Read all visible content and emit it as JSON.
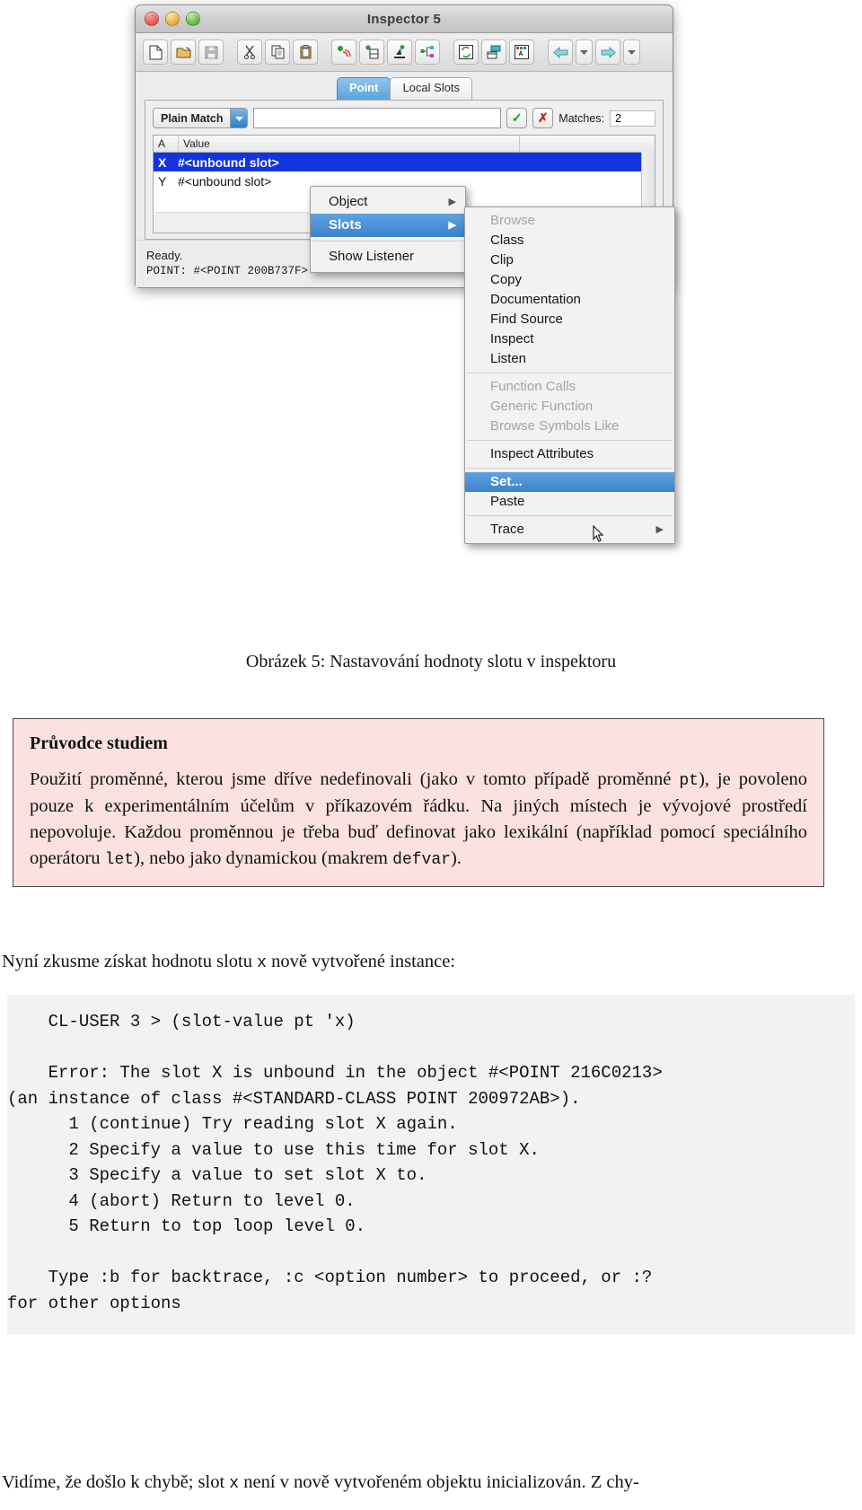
{
  "window": {
    "title": "Inspector 5",
    "traffic_lights": [
      "close",
      "minimize",
      "zoom"
    ],
    "toolbar_icons": [
      "new-document-icon",
      "open-folder-icon",
      "save-disk-icon",
      "cut-scissors-icon",
      "copy-icon",
      "paste-clipboard-icon",
      "listener-icon",
      "clip-icon",
      "inspect-microscope-icon",
      "class-tree-icon",
      "refresh-icon",
      "browse-icon",
      "attributes-icon",
      "back-arrow-icon",
      "back-dropdown-icon",
      "forward-arrow-icon",
      "forward-dropdown-icon"
    ],
    "tabs": [
      {
        "label": "Point",
        "active": true
      },
      {
        "label": "Local Slots",
        "active": false
      }
    ],
    "filter": {
      "match_mode": "Plain Match",
      "match_mode_options": [
        "Plain Match"
      ],
      "query_value": "",
      "query_placeholder": "",
      "accept_icon": "check-icon",
      "reject_icon": "cross-icon",
      "matches_label": "Matches:",
      "matches_count": "2"
    },
    "slot_table": {
      "columns": [
        "A",
        "Value"
      ],
      "rows": [
        {
          "name": "X",
          "value": "#<unbound slot>",
          "selected": true
        },
        {
          "name": "Y",
          "value": "#<unbound slot>",
          "selected": false
        }
      ]
    },
    "status": {
      "line1": "Ready.",
      "line2": "POINT: #<POINT 200B737F>"
    }
  },
  "context_menu": {
    "items": [
      {
        "label": "Object",
        "submenu": true,
        "highlighted": false,
        "disabled": false
      },
      {
        "label": "Slots",
        "submenu": true,
        "highlighted": true,
        "disabled": false
      },
      {
        "separator": true
      },
      {
        "label": "Show Listener",
        "submenu": false,
        "highlighted": false,
        "disabled": false
      }
    ]
  },
  "submenu": {
    "items": [
      {
        "label": "Browse",
        "disabled": true,
        "highlighted": false,
        "submenu": false
      },
      {
        "label": "Class",
        "disabled": false,
        "highlighted": false,
        "submenu": false
      },
      {
        "label": "Clip",
        "disabled": false,
        "highlighted": false,
        "submenu": false
      },
      {
        "label": "Copy",
        "disabled": false,
        "highlighted": false,
        "submenu": false
      },
      {
        "label": "Documentation",
        "disabled": false,
        "highlighted": false,
        "submenu": false
      },
      {
        "label": "Find Source",
        "disabled": false,
        "highlighted": false,
        "submenu": false
      },
      {
        "label": "Inspect",
        "disabled": false,
        "highlighted": false,
        "submenu": false
      },
      {
        "label": "Listen",
        "disabled": false,
        "highlighted": false,
        "submenu": false
      },
      {
        "separator": true
      },
      {
        "label": "Function Calls",
        "disabled": true,
        "highlighted": false,
        "submenu": false
      },
      {
        "label": "Generic Function",
        "disabled": true,
        "highlighted": false,
        "submenu": false
      },
      {
        "label": "Browse Symbols Like",
        "disabled": true,
        "highlighted": false,
        "submenu": false
      },
      {
        "separator": true
      },
      {
        "label": "Inspect Attributes",
        "disabled": false,
        "highlighted": false,
        "submenu": false
      },
      {
        "separator": true
      },
      {
        "label": "Set...",
        "disabled": false,
        "highlighted": true,
        "submenu": false
      },
      {
        "label": "Paste",
        "disabled": false,
        "highlighted": false,
        "submenu": false
      },
      {
        "separator": true
      },
      {
        "label": "Trace",
        "disabled": false,
        "highlighted": false,
        "submenu": true
      }
    ]
  },
  "document": {
    "caption": "Obrázek 5: Nastavování hodnoty slotu v inspektoru",
    "callout": {
      "heading": "Průvodce studiem",
      "body_part1": "Použití proměnné, kterou jsme dříve nedefinovali (jako v tomto případě proměnné ",
      "code1": "pt",
      "body_part2": "), je povoleno pouze k experimentálním účelům v příkazovém řádku. Na jiných místech je vývojové prostředí nepovoluje. Každou proměnnou je třeba buď definovat jako lexikální (například pomocí speciálního operátoru ",
      "code2": "let",
      "body_part3": "), nebo jako dynamickou (makrem ",
      "code3": "defvar",
      "body_part4": ")."
    },
    "intro_part1": "Nyní zkusme získat hodnotu slotu ",
    "intro_code": "x",
    "intro_part2": " nově vytvořené instance:",
    "code_listing": "    CL-USER 3 > (slot-value pt 'x)\n\n    Error: The slot X is unbound in the object #<POINT 216C0213>\n(an instance of class #<STANDARD-CLASS POINT 200972AB>).\n      1 (continue) Try reading slot X again.\n      2 Specify a value to use this time for slot X.\n      3 Specify a value to set slot X to.\n      4 (abort) Return to level 0.\n      5 Return to top loop level 0.\n\n    Type :b for backtrace, :c <option number> to proceed, or :?\nfor other options",
    "outro_part1": "Vidíme, že došlo k chybě; slot ",
    "outro_code": "x",
    "outro_part2": " není v nově vytvořeném objektu inicializován. Z chy-"
  },
  "colors": {
    "selection_blue": "#1433e0",
    "menu_highlight": "#3b82cc",
    "tab_active": "#5ba4da",
    "callout_bg": "#fbe2e0",
    "code_bg": "#f2f2f2"
  }
}
